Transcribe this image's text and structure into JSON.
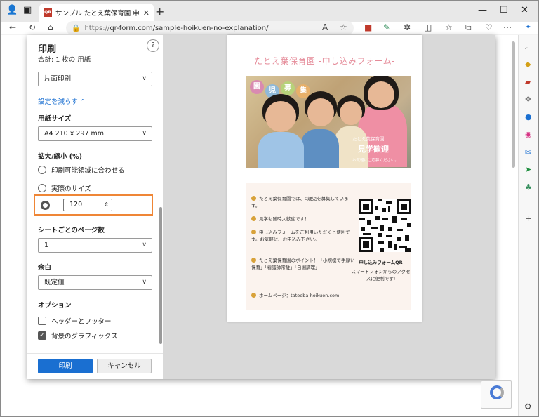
{
  "browser": {
    "tab_title": "サンプル たとえ葉保育園 申し込み",
    "tab_favicon": "QR",
    "url_scheme": "https://",
    "url_rest": "qr-form.com/sample-hoikuen-no-explanation/"
  },
  "print": {
    "title": "印刷",
    "sheet_count": "合計: 1 枚の 用紙",
    "sides": "片面印刷",
    "fewer_settings": "設定を減らす ⌃",
    "paper_size_label": "用紙サイズ",
    "paper_size": "A4 210 x 297 mm",
    "scale_label": "拡大/縮小 (%)",
    "fit_option": "印刷可能領域に合わせる",
    "actual_option": "実際のサイズ",
    "scale_value": "120",
    "pages_per_sheet_label": "シートごとのページ数",
    "pages_per_sheet": "1",
    "margins_label": "余白",
    "margins": "既定値",
    "options_label": "オプション",
    "header_footer": "ヘッダーとフッター",
    "background_graphics": "背景のグラフィックス",
    "print_button": "印刷",
    "cancel_button": "キャンセル"
  },
  "preview": {
    "title": "たとえ葉保育園 -申し込みフォーム-",
    "bubbles": [
      "園",
      "児",
      "募",
      "集"
    ],
    "photo_org": "たとえ葉保育園",
    "photo_event": "見学歓迎",
    "photo_note": "お気軽にご応募ください。",
    "items": [
      "たとえ葉保育園では、0歳児を募集しています。",
      "見学も随時大歓迎です！",
      "申し込みフォームをご利用いただくと便利です。お気軽に、お申込み下さい。",
      "たとえ葉保育園のポイント！「小規模で手厚い保育」「看護師常駐」「自園調理」",
      "ホームページ：tatoeba-hoikuen.com"
    ],
    "qr_caption": "申し込みフォームQR",
    "qr_sub": "スマートフォンからのアクセスに便利です!"
  },
  "colors": {
    "accent": "#1a6fd1",
    "highlight": "#ef8636",
    "title_pink": "#e58b99"
  }
}
